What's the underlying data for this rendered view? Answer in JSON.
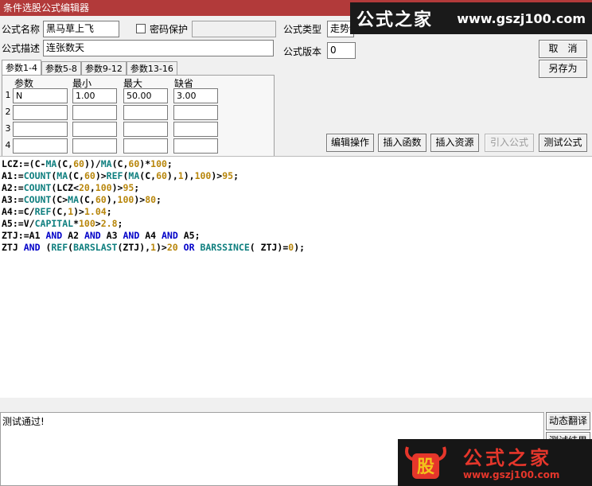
{
  "window": {
    "title": "条件选股公式编辑器"
  },
  "watermark_top": {
    "brand": "公式之家",
    "url": "www.gszj100.com"
  },
  "form": {
    "name_label": "公式名称",
    "name_value": "黑马草上飞",
    "password_label": "密码保护",
    "password_checked": false,
    "password_value": "",
    "type_label": "公式类型",
    "type_value": "走势特征",
    "desc_label": "公式描述",
    "desc_value": "连张数天",
    "version_label": "公式版本",
    "version_value": "0"
  },
  "buttons": {
    "cancel": "取　消",
    "save_as": "另存为",
    "edit_ops": "编辑操作",
    "insert_func": "插入函数",
    "insert_res": "插入资源",
    "import_formula": "引入公式",
    "test_formula": "测试公式",
    "dynamic_translate": "动态翻译",
    "test_result": "测试结果"
  },
  "tabs": [
    "参数1-4",
    "参数5-8",
    "参数9-12",
    "参数13-16"
  ],
  "param_table": {
    "headers": [
      "参数",
      "最小",
      "最大",
      "缺省"
    ],
    "row_numbers": [
      "1",
      "2",
      "3",
      "4"
    ],
    "rows": [
      [
        "N",
        "1.00",
        "50.00",
        "3.00"
      ],
      [
        "",
        "",
        "",
        ""
      ],
      [
        "",
        "",
        "",
        ""
      ],
      [
        "",
        "",
        "",
        ""
      ]
    ]
  },
  "code_lines": [
    "LCZ:=(C-MA(C,60))/MA(C,60)*100;",
    "A1:=COUNT(MA(C,60)>REF(MA(C,60),1),100)>95;",
    "A2:=COUNT(LCZ<20,100)>95;",
    "A3:=COUNT(C>MA(C,60),100)>80;",
    "A4:=C/REF(C,1)>1.04;",
    "A5:=V/CAPITAL*100>2.8;",
    "ZTJ:=A1 AND A2 AND A3 AND A4 AND A5;",
    "ZTJ AND (REF(BARSLAST(ZTJ),1)>20 OR BARSSINCE( ZTJ)=0);"
  ],
  "status": {
    "text": "测试通过!"
  },
  "watermark_bottom": {
    "logo_char": "股",
    "brand": "公式之家",
    "url": "www.gszj100.com"
  },
  "colors": {
    "titlebar": "#b23a3a",
    "code_function": "#0f7f7f",
    "code_number": "#b8860b",
    "code_operator": "#0000c8",
    "watermark_red": "#e5362b"
  }
}
